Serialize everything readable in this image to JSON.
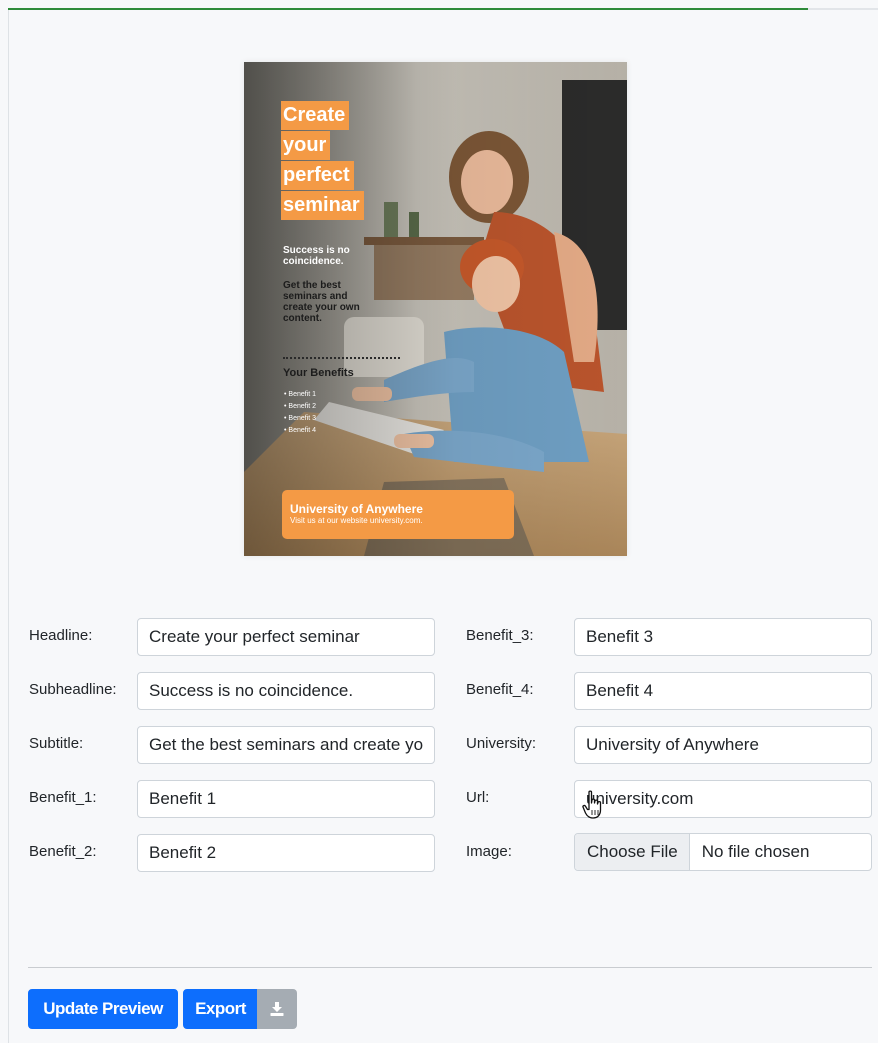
{
  "progress": {
    "fraction": 0.92,
    "color": "#2e8b3a"
  },
  "poster": {
    "headline_lines": [
      "Create",
      "your",
      "perfect",
      "seminar"
    ],
    "subheadline_lines": [
      "Success is no",
      "coincidence."
    ],
    "subtitle_lines": [
      "Get the best",
      "seminars and",
      "create your own",
      "content."
    ],
    "benefits_title": "Your Benefits",
    "benefits": [
      "• Benefit 1",
      "• Benefit 2",
      "• Benefit 3",
      "• Benefit 4"
    ],
    "footer_university": "University of Anywhere",
    "footer_visit": "Visit us at our website university.com.",
    "accent_color": "#f49a45"
  },
  "form": {
    "headline": {
      "label": "Headline:",
      "value": "Create your perfect seminar"
    },
    "subheadline": {
      "label": "Subheadline:",
      "value": "Success is no coincidence."
    },
    "subtitle": {
      "label": "Subtitle:",
      "value": "Get the best seminars and create your own content."
    },
    "benefit_1": {
      "label": "Benefit_1:",
      "value": "Benefit 1"
    },
    "benefit_2": {
      "label": "Benefit_2:",
      "value": "Benefit 2"
    },
    "benefit_3": {
      "label": "Benefit_3:",
      "value": "Benefit 3"
    },
    "benefit_4": {
      "label": "Benefit_4:",
      "value": "Benefit 4"
    },
    "university": {
      "label": "University:",
      "value": "University of Anywhere"
    },
    "url": {
      "label": "Url:",
      "value": "university.com"
    },
    "image": {
      "label": "Image:",
      "button": "Choose File",
      "status": "No file chosen"
    }
  },
  "actions": {
    "update_label": "Update Preview",
    "export_label": "Export",
    "export_icon": "download-icon",
    "primary_color": "#0d6efd"
  }
}
